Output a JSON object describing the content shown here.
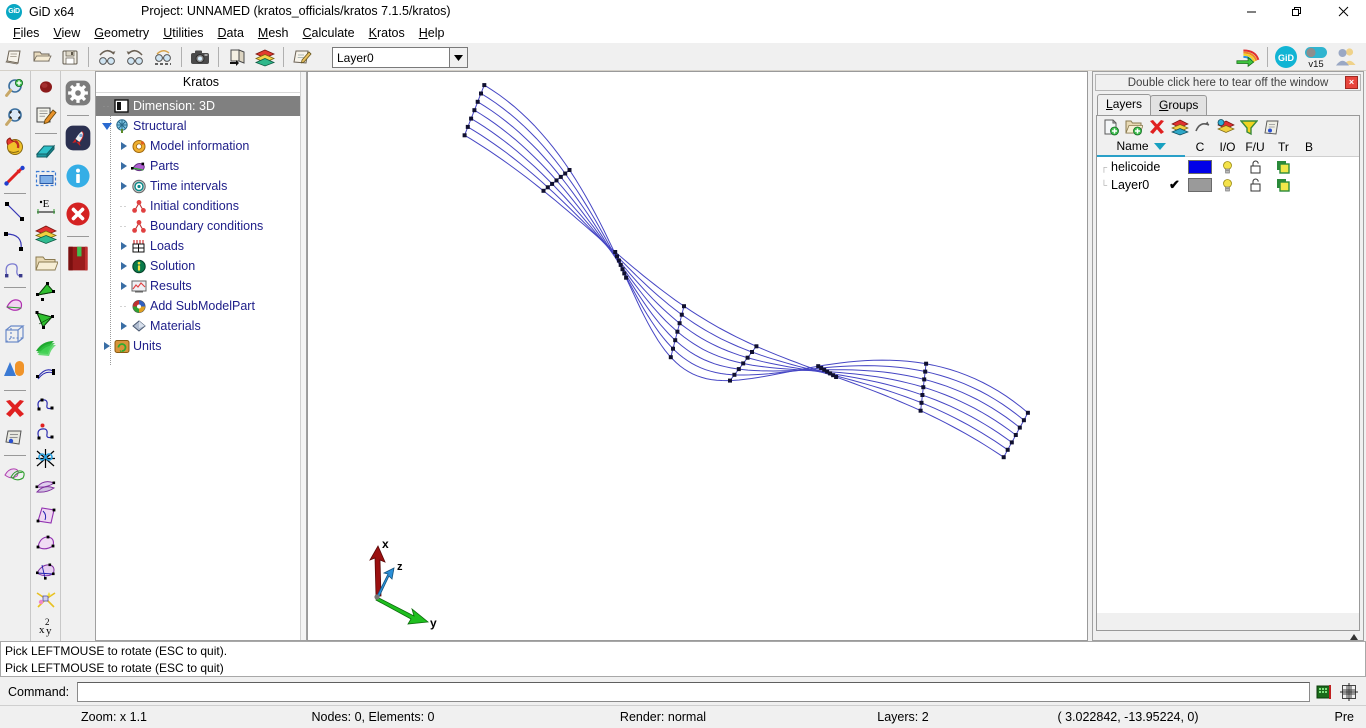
{
  "window": {
    "app_name": "GiD x64",
    "logo_text": "GiD",
    "project_title": "Project: UNNAMED (kratos_officials/kratos 7.1.5/kratos)",
    "minimize": "—",
    "maximize": "❐",
    "close": "✕"
  },
  "menu": {
    "items": [
      {
        "label": "Files",
        "accel": "F"
      },
      {
        "label": "View",
        "accel": "V"
      },
      {
        "label": "Geometry",
        "accel": "G"
      },
      {
        "label": "Utilities",
        "accel": "U"
      },
      {
        "label": "Data",
        "accel": "D"
      },
      {
        "label": "Mesh",
        "accel": "M"
      },
      {
        "label": "Calculate",
        "accel": "C"
      },
      {
        "label": "Kratos",
        "accel": "K"
      },
      {
        "label": "Help",
        "accel": "H"
      }
    ]
  },
  "toolbar": {
    "buttons": [
      {
        "name": "new-project-icon",
        "title": "New"
      },
      {
        "name": "open-project-icon",
        "title": "Open"
      },
      {
        "name": "save-project-icon",
        "title": "Save"
      },
      {
        "name": "undo-view-icon",
        "title": "Undo view"
      },
      {
        "name": "redo-view-icon",
        "title": "Redo view"
      },
      {
        "name": "zoom-frame-icon",
        "title": "Zoom frame"
      },
      {
        "name": "print-screenshot-icon",
        "title": "Print / capture"
      },
      {
        "name": "open-layers-icon",
        "title": "Layers"
      },
      {
        "name": "layers-stack-icon",
        "title": "Layer stack"
      },
      {
        "name": "edit-note-icon",
        "title": "Annotate"
      }
    ],
    "layer_combo_value": "Layer0",
    "right_icons": [
      {
        "name": "rainbow-arrow-icon",
        "title": "Results"
      },
      {
        "name": "gid-logo-icon",
        "title": "GiD",
        "label": "GiD"
      },
      {
        "name": "toggle-version-icon",
        "title": "Version",
        "label": "v15"
      },
      {
        "name": "users-icon",
        "title": "Community"
      }
    ]
  },
  "left_toolbar": {
    "column1": [
      {
        "name": "zoom-in-icon"
      },
      {
        "name": "zoom-frame-icon"
      },
      {
        "name": "rotate-trackball-icon"
      },
      {
        "name": "rotate-axis-icon"
      },
      {
        "name": "sep"
      },
      {
        "name": "create-line-icon"
      },
      {
        "name": "create-arc-icon"
      },
      {
        "name": "create-nurbs-curve-icon"
      },
      {
        "name": "sep"
      },
      {
        "name": "create-nurbs-surface-icon"
      },
      {
        "name": "create-volume-icon"
      },
      {
        "name": "create-object-icon"
      },
      {
        "name": "sep"
      },
      {
        "name": "delete-entity-icon"
      },
      {
        "name": "list-entities-icon"
      },
      {
        "name": "sep"
      },
      {
        "name": "copy-surface-icon"
      }
    ],
    "column2": [
      {
        "name": "create-point-icon"
      },
      {
        "name": "edit-geometry-icon"
      },
      {
        "name": "sep"
      },
      {
        "name": "layer-switch-icon"
      },
      {
        "name": "select-rectangle-icon"
      },
      {
        "name": "label-entities-icon"
      },
      {
        "name": "layers-color-icon"
      },
      {
        "name": "open-folder-icon"
      },
      {
        "name": "mesh-surface-icon"
      },
      {
        "name": "mesh-volume-icon"
      },
      {
        "name": "render-surfaces-icon"
      },
      {
        "name": "move-entity-icon"
      },
      {
        "name": "edit-curve-icon"
      },
      {
        "name": "divide-curve-icon"
      },
      {
        "name": "intersect-cut-icon"
      },
      {
        "name": "swap-surface-icon"
      },
      {
        "name": "trim-surface-icon"
      },
      {
        "name": "hole-surface-icon"
      },
      {
        "name": "collapse-geometry-icon"
      },
      {
        "name": "explode-icon"
      },
      {
        "name": "power-icon"
      }
    ],
    "column3": [
      {
        "name": "settings-gear-icon"
      },
      {
        "name": "sep"
      },
      {
        "name": "start-rocket-icon"
      },
      {
        "name": "info-icon"
      },
      {
        "name": "stop-error-icon"
      },
      {
        "name": "sep"
      },
      {
        "name": "manual-book-icon"
      }
    ]
  },
  "tree": {
    "title": "Kratos",
    "items": [
      {
        "label": "Dimension: 3D",
        "icon": "dimension-icon",
        "indent": 0,
        "expander": "none",
        "selected": true
      },
      {
        "label": "Structural",
        "icon": "structural-tree-icon",
        "indent": 0,
        "expander": "open",
        "selected": false
      },
      {
        "label": "Model information",
        "icon": "model-information-icon",
        "indent": 1,
        "expander": "closed",
        "selected": false
      },
      {
        "label": "Parts",
        "icon": "parts-icon",
        "indent": 1,
        "expander": "closed",
        "selected": false
      },
      {
        "label": "Time intervals",
        "icon": "time-intervals-icon",
        "indent": 1,
        "expander": "closed",
        "selected": false
      },
      {
        "label": "Initial conditions",
        "icon": "initial-conditions-icon",
        "indent": 1,
        "expander": "none",
        "selected": false
      },
      {
        "label": "Boundary conditions",
        "icon": "boundary-conditions-icon",
        "indent": 1,
        "expander": "none",
        "selected": false
      },
      {
        "label": "Loads",
        "icon": "loads-icon",
        "indent": 1,
        "expander": "closed",
        "selected": false
      },
      {
        "label": "Solution",
        "icon": "solution-icon",
        "indent": 1,
        "expander": "closed",
        "selected": false
      },
      {
        "label": "Results",
        "icon": "results-icon",
        "indent": 1,
        "expander": "closed",
        "selected": false
      },
      {
        "label": "Add SubModelPart",
        "icon": "add-submodelpart-icon",
        "indent": 1,
        "expander": "none",
        "selected": false
      },
      {
        "label": "Materials",
        "icon": "materials-icon",
        "indent": 1,
        "expander": "closed",
        "selected": false
      },
      {
        "label": "Units",
        "icon": "units-icon",
        "indent": 0,
        "expander": "closed",
        "selected": false
      }
    ]
  },
  "right_panel": {
    "tearoff_text": "Double click here to tear off the window",
    "tearoff_close": "×",
    "tabs": [
      {
        "label": "Layers",
        "active": true
      },
      {
        "label": "Groups",
        "active": false
      }
    ],
    "toolbar_icons": [
      {
        "name": "new-layer-icon"
      },
      {
        "name": "new-layer-group-icon"
      },
      {
        "name": "delete-layer-icon"
      },
      {
        "name": "layer-color-icon"
      },
      {
        "name": "send-to-layer-icon"
      },
      {
        "name": "layer-visibility-icon"
      },
      {
        "name": "filter-layers-icon"
      },
      {
        "name": "layer-properties-icon"
      }
    ],
    "columns": [
      "Name",
      "C",
      "I/O",
      "F/U",
      "Tr",
      "B"
    ],
    "rows": [
      {
        "name": "helicoide",
        "selected": false,
        "color": "#0000e8",
        "on": true,
        "locked": false,
        "transparent": true
      },
      {
        "name": "Layer0",
        "selected": true,
        "color": "#9a9a9a",
        "on": true,
        "locked": false,
        "transparent": true
      }
    ]
  },
  "viewport": {
    "axes": [
      {
        "label": "x",
        "color": "#9b1010"
      },
      {
        "label": "y",
        "color": "#1fbf1f"
      },
      {
        "label": "z",
        "color": "#2a8fd8"
      }
    ],
    "geometry_name": "helicoide-wireframe",
    "line_color": "#4444c0",
    "point_color": "#101030"
  },
  "messages": {
    "lines": [
      "Pick LEFTMOUSE to rotate (ESC to quit).",
      "Pick LEFTMOUSE to rotate (ESC to quit)"
    ]
  },
  "command": {
    "label": "Command:",
    "value": "",
    "placeholder": "",
    "icons": [
      {
        "name": "command-history-icon"
      },
      {
        "name": "grid-snap-icon"
      }
    ]
  },
  "statusbar": {
    "zoom": "Zoom: x 1.1",
    "counts": "Nodes: 0, Elements: 0",
    "render": "Render: normal",
    "layers": "Layers: 2",
    "coords": "( 3.022842, -13.95224,  0)",
    "mode": "Pre"
  }
}
